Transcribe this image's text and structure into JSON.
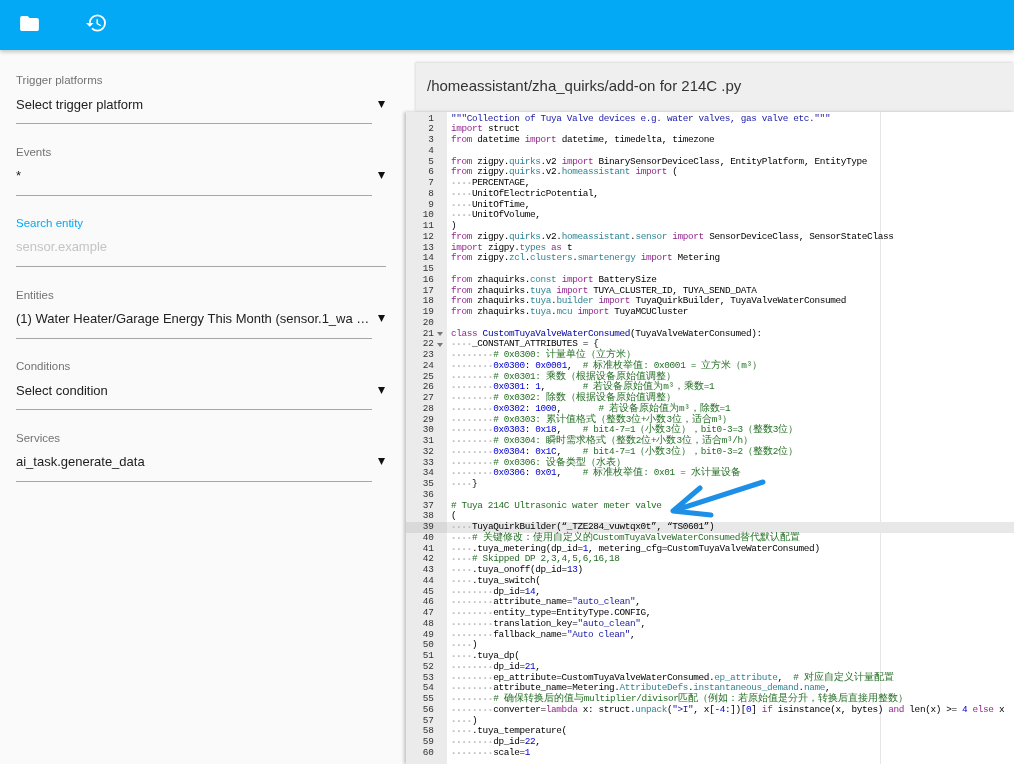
{
  "sidebar": {
    "fields": [
      {
        "kind": "select",
        "label": "Trigger platforms",
        "value": "Select trigger platform",
        "focused": false
      },
      {
        "kind": "select",
        "label": "Events",
        "value": "*",
        "focused": false
      },
      {
        "kind": "input",
        "label": "Search entity",
        "placeholder": "sensor.example",
        "focused": true
      },
      {
        "kind": "select",
        "label": "Entities",
        "value": "(1) Water Heater/Garage Energy This Month (sensor.1_wa …",
        "focused": false
      },
      {
        "kind": "select",
        "label": "Conditions",
        "value": "Select condition",
        "focused": false
      },
      {
        "kind": "select",
        "label": "Services",
        "value": "ai_task.generate_data",
        "focused": false
      }
    ]
  },
  "editor": {
    "file_path": "/homeassistant/zha_quirks/add-on for 214C .py",
    "lines": [
      {
        "number": "1",
        "fold": false,
        "active": false,
        "code": [
          {
            "kind": "string",
            "text": "\"\"\"Collection of Tuya Valve devices e.g. water valves, gas valve etc.\"\"\""
          }
        ]
      },
      {
        "number": "2",
        "fold": false,
        "active": false,
        "code": [
          {
            "kind": "keyword",
            "text": "import"
          },
          {
            "kind": "plain",
            "text": " struct"
          }
        ]
      },
      {
        "number": "3",
        "fold": false,
        "active": false,
        "code": [
          {
            "kind": "keyword",
            "text": "from"
          },
          {
            "kind": "plain",
            "text": " datetime "
          },
          {
            "kind": "keyword",
            "text": "import"
          },
          {
            "kind": "plain",
            "text": " datetime, timedelta, timezone"
          }
        ]
      },
      {
        "number": "4",
        "fold": false,
        "active": false
      },
      {
        "number": "5",
        "fold": false,
        "active": false,
        "code": [
          {
            "kind": "keyword",
            "text": "from"
          },
          {
            "kind": "plain",
            "text": " zigpy."
          },
          {
            "kind": "module",
            "text": "quirks"
          },
          {
            "kind": "plain",
            "text": ".v2 "
          },
          {
            "kind": "keyword",
            "text": "import"
          },
          {
            "kind": "plain",
            "text": " BinarySensorDeviceClass, EntityPlatform, EntityType"
          }
        ]
      },
      {
        "number": "6",
        "fold": false,
        "active": false,
        "code": [
          {
            "kind": "keyword",
            "text": "from"
          },
          {
            "kind": "plain",
            "text": " zigpy."
          },
          {
            "kind": "module",
            "text": "quirks"
          },
          {
            "kind": "plain",
            "text": ".v2."
          },
          {
            "kind": "module",
            "text": "homeassistant"
          },
          {
            "kind": "keyword",
            "text": " import"
          },
          {
            "kind": "plain",
            "text": " ("
          }
        ]
      },
      {
        "number": "7",
        "fold": false,
        "active": false,
        "code": [
          {
            "kind": "plain",
            "text": "    PERCENTAGE,"
          }
        ]
      },
      {
        "number": "8",
        "fold": false,
        "active": false,
        "code": [
          {
            "kind": "plain",
            "text": "    UnitOfElectricPotential,"
          }
        ]
      },
      {
        "number": "9",
        "fold": false,
        "active": false,
        "code": [
          {
            "kind": "plain",
            "text": "    UnitOfTime,"
          }
        ]
      },
      {
        "number": "10",
        "fold": false,
        "active": false,
        "code": [
          {
            "kind": "plain",
            "text": "    UnitOfVolume,"
          }
        ]
      },
      {
        "number": "11",
        "fold": false,
        "active": false,
        "code": [
          {
            "kind": "plain",
            "text": ")"
          }
        ]
      },
      {
        "number": "12",
        "fold": false,
        "active": false,
        "code": [
          {
            "kind": "keyword",
            "text": "from"
          },
          {
            "kind": "plain",
            "text": " zigpy."
          },
          {
            "kind": "module",
            "text": "quirks"
          },
          {
            "kind": "plain",
            "text": ".v2."
          },
          {
            "kind": "module",
            "text": "homeassistant"
          },
          {
            "kind": "plain",
            "text": "."
          },
          {
            "kind": "module",
            "text": "sensor"
          },
          {
            "kind": "keyword",
            "text": " import"
          },
          {
            "kind": "plain",
            "text": " SensorDeviceClass, SensorStateClass"
          }
        ]
      },
      {
        "number": "13",
        "fold": false,
        "active": false,
        "code": [
          {
            "kind": "keyword",
            "text": "import"
          },
          {
            "kind": "plain",
            "text": " zigpy."
          },
          {
            "kind": "module",
            "text": "types"
          },
          {
            "kind": "keyword",
            "text": " as"
          },
          {
            "kind": "plain",
            "text": " t"
          }
        ]
      },
      {
        "number": "14",
        "fold": false,
        "active": false,
        "code": [
          {
            "kind": "keyword",
            "text": "from"
          },
          {
            "kind": "plain",
            "text": " zigpy."
          },
          {
            "kind": "module",
            "text": "zcl"
          },
          {
            "kind": "plain",
            "text": "."
          },
          {
            "kind": "module",
            "text": "clusters"
          },
          {
            "kind": "plain",
            "text": "."
          },
          {
            "kind": "module",
            "text": "smartenergy"
          },
          {
            "kind": "keyword",
            "text": " import"
          },
          {
            "kind": "plain",
            "text": " Metering"
          }
        ]
      },
      {
        "number": "15",
        "fold": false,
        "active": false
      },
      {
        "number": "16",
        "fold": false,
        "active": false,
        "code": [
          {
            "kind": "keyword",
            "text": "from"
          },
          {
            "kind": "plain",
            "text": " zhaquirks."
          },
          {
            "kind": "module",
            "text": "const"
          },
          {
            "kind": "keyword",
            "text": " import"
          },
          {
            "kind": "plain",
            "text": " BatterySize"
          }
        ]
      },
      {
        "number": "17",
        "fold": false,
        "active": false,
        "code": [
          {
            "kind": "keyword",
            "text": "from"
          },
          {
            "kind": "plain",
            "text": " zhaquirks."
          },
          {
            "kind": "module",
            "text": "tuya"
          },
          {
            "kind": "keyword",
            "text": " import"
          },
          {
            "kind": "plain",
            "text": " TUYA_CLUSTER_ID, TUYA_SEND_DATA"
          }
        ]
      },
      {
        "number": "18",
        "fold": false,
        "active": false,
        "code": [
          {
            "kind": "keyword",
            "text": "from"
          },
          {
            "kind": "plain",
            "text": " zhaquirks."
          },
          {
            "kind": "module",
            "text": "tuya"
          },
          {
            "kind": "plain",
            "text": "."
          },
          {
            "kind": "module",
            "text": "builder"
          },
          {
            "kind": "keyword",
            "text": " import"
          },
          {
            "kind": "plain",
            "text": " TuyaQuirkBuilder, TuyaValveWaterConsumed"
          }
        ]
      },
      {
        "number": "19",
        "fold": false,
        "active": false,
        "code": [
          {
            "kind": "keyword",
            "text": "from"
          },
          {
            "kind": "plain",
            "text": " zhaquirks."
          },
          {
            "kind": "module",
            "text": "tuya"
          },
          {
            "kind": "plain",
            "text": "."
          },
          {
            "kind": "module",
            "text": "mcu"
          },
          {
            "kind": "keyword",
            "text": " import"
          },
          {
            "kind": "plain",
            "text": " TuyaMCUCluster"
          }
        ]
      },
      {
        "number": "20",
        "fold": false,
        "active": false
      },
      {
        "number": "21",
        "fold": true,
        "active": false,
        "code": [
          {
            "kind": "keyword",
            "text": "class"
          },
          {
            "kind": "class_name",
            "text": " CustomTuyaValveWaterConsumed"
          },
          {
            "kind": "plain",
            "text": "(TuyaValveWaterConsumed):"
          }
        ]
      },
      {
        "number": "22",
        "fold": true,
        "active": false,
        "code": [
          {
            "kind": "plain",
            "text": "    _CONSTANT_ATTRIBUTES = {"
          }
        ]
      },
      {
        "number": "23",
        "fold": false,
        "active": false,
        "code": [
          {
            "kind": "comment",
            "text": "        # 0x0300: 计量单位（立方米）"
          }
        ]
      },
      {
        "number": "24",
        "fold": false,
        "active": false,
        "code": [
          {
            "kind": "number",
            "text": "        0x0300"
          },
          {
            "kind": "plain",
            "text": ": "
          },
          {
            "kind": "number",
            "text": "0x0001"
          },
          {
            "kind": "plain",
            "text": ",  "
          },
          {
            "kind": "comment",
            "text": "# 标准枚举值: 0x0001 = 立方米（m³）"
          }
        ]
      },
      {
        "number": "25",
        "fold": false,
        "active": false,
        "code": [
          {
            "kind": "comment",
            "text": "        # 0x0301: 乘数（根据设备原始值调整）"
          }
        ]
      },
      {
        "number": "26",
        "fold": false,
        "active": false,
        "code": [
          {
            "kind": "number",
            "text": "        0x0301"
          },
          {
            "kind": "plain",
            "text": ": "
          },
          {
            "kind": "number",
            "text": "1"
          },
          {
            "kind": "plain",
            "text": ",       "
          },
          {
            "kind": "comment",
            "text": "# 若设备原始值为m³，乘数=1"
          }
        ]
      },
      {
        "number": "27",
        "fold": false,
        "active": false,
        "code": [
          {
            "kind": "comment",
            "text": "        # 0x0302: 除数（根据设备原始值调整）"
          }
        ]
      },
      {
        "number": "28",
        "fold": false,
        "active": false,
        "code": [
          {
            "kind": "number",
            "text": "        0x0302"
          },
          {
            "kind": "plain",
            "text": ": "
          },
          {
            "kind": "number",
            "text": "1000"
          },
          {
            "kind": "plain",
            "text": ",       "
          },
          {
            "kind": "comment",
            "text": "# 若设备原始值为m³，除数=1"
          }
        ]
      },
      {
        "number": "29",
        "fold": false,
        "active": false,
        "code": [
          {
            "kind": "comment",
            "text": "        # 0x0303: 累计值格式（整数3位+小数3位，适合m³）"
          }
        ]
      },
      {
        "number": "30",
        "fold": false,
        "active": false,
        "code": [
          {
            "kind": "number",
            "text": "        0x0303"
          },
          {
            "kind": "plain",
            "text": ": "
          },
          {
            "kind": "number",
            "text": "0x18"
          },
          {
            "kind": "plain",
            "text": ",    "
          },
          {
            "kind": "comment",
            "text": "# bit4-7=1（小数3位），bit0-3=3（整数3位）"
          }
        ]
      },
      {
        "number": "31",
        "fold": false,
        "active": false,
        "code": [
          {
            "kind": "comment",
            "text": "        # 0x0304: 瞬时需求格式（整数2位+小数3位，适合m³/h）"
          }
        ]
      },
      {
        "number": "32",
        "fold": false,
        "active": false,
        "code": [
          {
            "kind": "number",
            "text": "        0x0304"
          },
          {
            "kind": "plain",
            "text": ": "
          },
          {
            "kind": "number",
            "text": "0x1C"
          },
          {
            "kind": "plain",
            "text": ",    "
          },
          {
            "kind": "comment",
            "text": "# bit4-7=1（小数3位），bit0-3=2（整数2位）"
          }
        ]
      },
      {
        "number": "33",
        "fold": false,
        "active": false,
        "code": [
          {
            "kind": "comment",
            "text": "        # 0x0306: 设备类型（水表）"
          }
        ]
      },
      {
        "number": "34",
        "fold": false,
        "active": false,
        "code": [
          {
            "kind": "number",
            "text": "        0x0306"
          },
          {
            "kind": "plain",
            "text": ": "
          },
          {
            "kind": "number",
            "text": "0x01"
          },
          {
            "kind": "plain",
            "text": ",    "
          },
          {
            "kind": "comment",
            "text": "# 标准枚举值: 0x01 = 水计量设备"
          }
        ]
      },
      {
        "number": "35",
        "fold": false,
        "active": false,
        "code": [
          {
            "kind": "plain",
            "text": "    }"
          }
        ]
      },
      {
        "number": "36",
        "fold": false,
        "active": false
      },
      {
        "number": "37",
        "fold": false,
        "active": false,
        "code": [
          {
            "kind": "comment",
            "text": "# Tuya 214C Ultrasonic water meter valve"
          }
        ]
      },
      {
        "number": "38",
        "fold": false,
        "active": false,
        "code": [
          {
            "kind": "plain",
            "text": "("
          }
        ]
      },
      {
        "number": "39",
        "fold": false,
        "active": true,
        "code": [
          {
            "kind": "plain",
            "text": "    TuyaQuirkBuilder(“_TZE284_vuwtqx0t”, “TS0601”)"
          }
        ]
      },
      {
        "number": "40",
        "fold": false,
        "active": false,
        "code": [
          {
            "kind": "comment",
            "text": "    # 关键修改：使用自定义的CustomTuyaValveWaterConsumed替代默认配置"
          }
        ]
      },
      {
        "number": "41",
        "fold": false,
        "active": false,
        "code": [
          {
            "kind": "plain",
            "text": "    .tuya_metering(dp_id="
          },
          {
            "kind": "number",
            "text": "1"
          },
          {
            "kind": "plain",
            "text": ", metering_cfg=CustomTuyaValveWaterConsumed)"
          }
        ]
      },
      {
        "number": "42",
        "fold": false,
        "active": false,
        "code": [
          {
            "kind": "comment",
            "text": "    # Skipped DP 2,3,4,5,6,16,18"
          }
        ]
      },
      {
        "number": "43",
        "fold": false,
        "active": false,
        "code": [
          {
            "kind": "plain",
            "text": "    .tuya_onoff(dp_id="
          },
          {
            "kind": "number",
            "text": "13"
          },
          {
            "kind": "plain",
            "text": ")"
          }
        ]
      },
      {
        "number": "44",
        "fold": false,
        "active": false,
        "code": [
          {
            "kind": "plain",
            "text": "    .tuya_switch("
          }
        ]
      },
      {
        "number": "45",
        "fold": false,
        "active": false,
        "code": [
          {
            "kind": "plain",
            "text": "        dp_id="
          },
          {
            "kind": "number",
            "text": "14"
          },
          {
            "kind": "plain",
            "text": ","
          }
        ]
      },
      {
        "number": "46",
        "fold": false,
        "active": false,
        "code": [
          {
            "kind": "plain",
            "text": "        attribute_name="
          },
          {
            "kind": "string",
            "text": "\"auto_clean\""
          },
          {
            "kind": "plain",
            "text": ","
          }
        ]
      },
      {
        "number": "47",
        "fold": false,
        "active": false,
        "code": [
          {
            "kind": "plain",
            "text": "        entity_type=EntityType.CONFIG,"
          }
        ]
      },
      {
        "number": "48",
        "fold": false,
        "active": false,
        "code": [
          {
            "kind": "plain",
            "text": "        translation_key="
          },
          {
            "kind": "string",
            "text": "\"auto_clean\""
          },
          {
            "kind": "plain",
            "text": ","
          }
        ]
      },
      {
        "number": "49",
        "fold": false,
        "active": false,
        "code": [
          {
            "kind": "plain",
            "text": "        fallback_name="
          },
          {
            "kind": "string",
            "text": "\"Auto clean\""
          },
          {
            "kind": "plain",
            "text": ","
          }
        ]
      },
      {
        "number": "50",
        "fold": false,
        "active": false,
        "code": [
          {
            "kind": "plain",
            "text": "    )"
          }
        ]
      },
      {
        "number": "51",
        "fold": false,
        "active": false,
        "code": [
          {
            "kind": "plain",
            "text": "    .tuya_dp("
          }
        ]
      },
      {
        "number": "52",
        "fold": false,
        "active": false,
        "code": [
          {
            "kind": "plain",
            "text": "        dp_id="
          },
          {
            "kind": "number",
            "text": "21"
          },
          {
            "kind": "plain",
            "text": ","
          }
        ]
      },
      {
        "number": "53",
        "fold": false,
        "active": false,
        "code": [
          {
            "kind": "plain",
            "text": "        ep_attribute=CustomTuyaValveWaterConsumed."
          },
          {
            "kind": "module",
            "text": "ep_attribute"
          },
          {
            "kind": "plain",
            "text": ",  "
          },
          {
            "kind": "comment",
            "text": "# 对应自定义计量配置"
          }
        ]
      },
      {
        "number": "54",
        "fold": false,
        "active": false,
        "code": [
          {
            "kind": "plain",
            "text": "        attribute_name=Metering."
          },
          {
            "kind": "module",
            "text": "AttributeDefs"
          },
          {
            "kind": "plain",
            "text": "."
          },
          {
            "kind": "module",
            "text": "instantaneous_demand"
          },
          {
            "kind": "plain",
            "text": "."
          },
          {
            "kind": "module",
            "text": "name"
          },
          {
            "kind": "plain",
            "text": ","
          }
        ]
      },
      {
        "number": "55",
        "fold": false,
        "active": false,
        "code": [
          {
            "kind": "comment",
            "text": "        # 确保转换后的值与multiplier/divisor匹配（例如：若原始值是分升，转换后直接用整数）"
          }
        ]
      },
      {
        "number": "56",
        "fold": false,
        "active": false,
        "code": [
          {
            "kind": "plain",
            "text": "        converter="
          },
          {
            "kind": "keyword",
            "text": "lambda"
          },
          {
            "kind": "plain",
            "text": " x: struct."
          },
          {
            "kind": "module",
            "text": "unpack"
          },
          {
            "kind": "plain",
            "text": "("
          },
          {
            "kind": "string",
            "text": "\">I\""
          },
          {
            "kind": "plain",
            "text": ", x[-"
          },
          {
            "kind": "number",
            "text": "4"
          },
          {
            "kind": "plain",
            "text": ":])["
          },
          {
            "kind": "number",
            "text": "0"
          },
          {
            "kind": "plain",
            "text": "] "
          },
          {
            "kind": "keyword",
            "text": "if"
          },
          {
            "kind": "plain",
            "text": " isinstance(x, bytes) "
          },
          {
            "kind": "keyword",
            "text": "and"
          },
          {
            "kind": "plain",
            "text": " len(x) >= "
          },
          {
            "kind": "number",
            "text": "4"
          },
          {
            "kind": "keyword",
            "text": " else"
          },
          {
            "kind": "plain",
            "text": " x"
          }
        ]
      },
      {
        "number": "57",
        "fold": false,
        "active": false,
        "code": [
          {
            "kind": "plain",
            "text": "    )"
          }
        ]
      },
      {
        "number": "58",
        "fold": false,
        "active": false,
        "code": [
          {
            "kind": "plain",
            "text": "    .tuya_temperature("
          }
        ]
      },
      {
        "number": "59",
        "fold": false,
        "active": false,
        "code": [
          {
            "kind": "plain",
            "text": "        dp_id="
          },
          {
            "kind": "number",
            "text": "22"
          },
          {
            "kind": "plain",
            "text": ","
          }
        ]
      },
      {
        "number": "60",
        "fold": false,
        "active": false,
        "code": [
          {
            "kind": "plain",
            "text": "        scale="
          },
          {
            "kind": "number",
            "text": "1"
          }
        ]
      }
    ]
  }
}
